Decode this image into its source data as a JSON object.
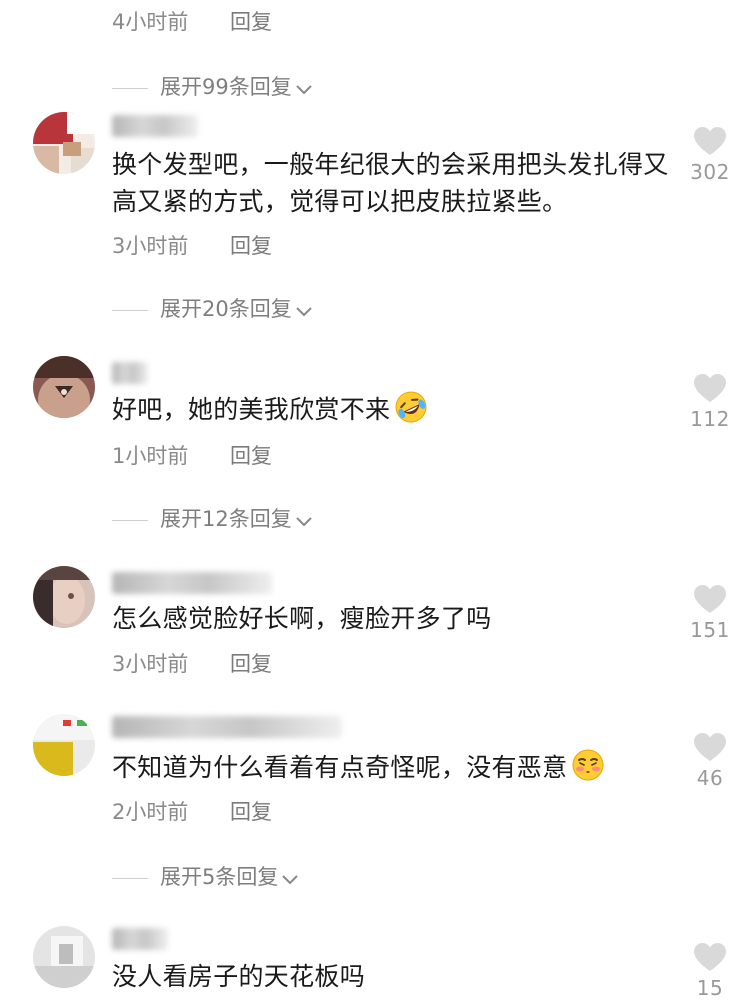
{
  "comments_top": {
    "time": "4小时前",
    "reply": "回复"
  },
  "expand_1": {
    "label": "展开99条回复"
  },
  "comments": [
    {
      "text": "换个发型吧，一般年纪很大的会采用把头发扎得又高又紧的方式，觉得可以把皮肤拉紧些。",
      "time": "3小时前",
      "reply": "回复",
      "likes": "302"
    },
    {
      "text": "好吧，她的美我欣赏不来",
      "emoji": "rolling-laughing-emoji",
      "time": "1小时前",
      "reply": "回复",
      "likes": "112"
    },
    {
      "text": "怎么感觉脸好长啊，瘦脸开多了吗",
      "time": "3小时前",
      "reply": "回复",
      "likes": "151"
    },
    {
      "text": "不知道为什么看着有点奇怪呢，没有恶意",
      "emoji": "smirking-blush-emoji",
      "time": "2小时前",
      "reply": "回复",
      "likes": "46"
    },
    {
      "text": "没人看房子的天花板吗",
      "likes": "15"
    }
  ],
  "expand_2": {
    "label": "展开20条回复"
  },
  "expand_3": {
    "label": "展开12条回复"
  },
  "expand_4": {
    "label": "展开5条回复"
  },
  "icons": {
    "like": "heart-icon",
    "expand": "chevron-down-icon"
  },
  "colors": {
    "text": "#1a1a1a",
    "meta": "#8a8a8a",
    "like": "#d9d9d9"
  }
}
